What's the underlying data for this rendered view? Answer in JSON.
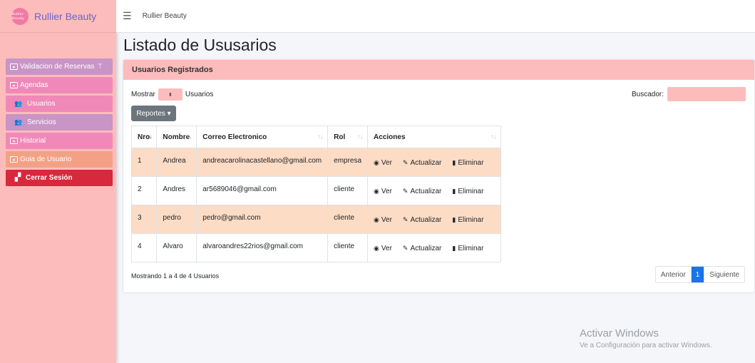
{
  "brand": {
    "logo_text": "Rullier Beauty",
    "name": "Rullier Beauty"
  },
  "topbar": {
    "title": "Rullier Beauty",
    "menu_icon": "hamburger-icon"
  },
  "sidebar": {
    "items": [
      {
        "label": "Validacion de Reservas",
        "icon": "calendar-icon"
      },
      {
        "label": "Agendas",
        "icon": "calendar-icon"
      },
      {
        "label": "Usuarios",
        "icon": "users-icon"
      },
      {
        "label": "Servicios",
        "icon": "users-icon"
      },
      {
        "label": "Historial",
        "icon": "calendar-icon"
      },
      {
        "label": "Guia de Usuario",
        "icon": "document-icon"
      },
      {
        "label": "Cerrar Sesión",
        "icon": "door-icon"
      }
    ],
    "colors": {
      "background": "#fdbcbc",
      "logout": "#d8283b"
    }
  },
  "page": {
    "title": "Listado de Ususarios"
  },
  "card": {
    "header": "Usuarios Registrados",
    "show_prefix": "Mostrar",
    "show_suffix": "Usuarios",
    "search_label": "Buscador:",
    "reports_label": "Reportes ▾",
    "table": {
      "headers": [
        "Nro",
        "Nombre",
        "Correo Electronico",
        "Rol",
        "Acciones"
      ],
      "rows": [
        {
          "nro": "1",
          "nombre": "Andrea",
          "correo": "andreacarolinacastellano@gmail.com",
          "rol": "empresa"
        },
        {
          "nro": "2",
          "nombre": "Andres",
          "correo": "ar5689046@gmail.com",
          "rol": "cliente"
        },
        {
          "nro": "3",
          "nombre": "pedro",
          "correo": "pedro@gmail.com",
          "rol": "cliente"
        },
        {
          "nro": "4",
          "nombre": "Alvaro",
          "correo": "alvaroandres22rios@gmail.com",
          "rol": "cliente"
        }
      ],
      "actions": {
        "view": "Ver",
        "update": "Actualizar",
        "delete": "Eliminar"
      }
    },
    "info": "Mostrando 1 a 4 de 4 Usuarios",
    "pagination": {
      "prev": "Anterior",
      "current": "1",
      "next": "Siguiente"
    }
  },
  "watermark": {
    "line1": "Activar Windows",
    "line2": "Ve a Configuración para activar Windows."
  },
  "colors": {
    "row_highlight": "#fddcc5",
    "accent_blue": "#1a73e8",
    "header_pink": "#fdbcbc"
  }
}
